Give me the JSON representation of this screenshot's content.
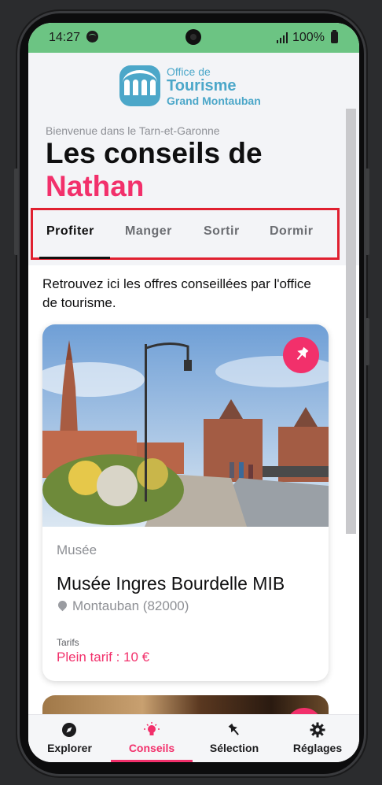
{
  "status_bar": {
    "time": "14:27",
    "battery": "100%"
  },
  "header": {
    "logo": {
      "line1": "Office de",
      "line2": "Tourisme",
      "line3": "Grand Montauban"
    },
    "welcome": "Bienvenue dans le Tarn-et-Garonne",
    "title_line1": "Les conseils de",
    "title_line2": "Nathan"
  },
  "tabs": [
    {
      "label": "Profiter",
      "active": true
    },
    {
      "label": "Manger",
      "active": false
    },
    {
      "label": "Sortir",
      "active": false
    },
    {
      "label": "Dormir",
      "active": false
    }
  ],
  "intro_text": "Retrouvez ici les offres conseillées par l'office de tourisme.",
  "cards": [
    {
      "category": "Musée",
      "name": "Musée Ingres Bourdelle MIB",
      "location": "Montauban (82000)",
      "tarif_label": "Tarifs",
      "price": "Plein tarif : 10 €"
    }
  ],
  "bottom_nav": [
    {
      "label": "Explorer",
      "icon": "compass-icon",
      "active": false
    },
    {
      "label": "Conseils",
      "icon": "lightbulb-icon",
      "active": true
    },
    {
      "label": "Sélection",
      "icon": "pin-icon",
      "active": false
    },
    {
      "label": "Réglages",
      "icon": "gear-icon",
      "active": false
    }
  ],
  "colors": {
    "accent": "#f2306b",
    "status_bar": "#6cc483",
    "logo": "#4ca7c9"
  }
}
